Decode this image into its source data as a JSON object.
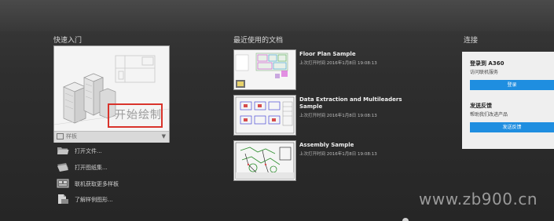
{
  "quick_start": {
    "title": "快速入门",
    "start_label": "开始绘制",
    "template_label": "样板",
    "links": [
      {
        "icon": "folder-open-icon",
        "label": "打开文件..."
      },
      {
        "icon": "sheet-set-icon",
        "label": "打开图纸集..."
      },
      {
        "icon": "online-templates-icon",
        "label": "联机获取更多样板"
      },
      {
        "icon": "sample-drawings-icon",
        "label": "了解样例图形..."
      }
    ]
  },
  "recent": {
    "title": "最近使用的文档",
    "items": [
      {
        "name": "Floor Plan Sample",
        "date": "上次打开时间 2016年1月8日 19:08:13"
      },
      {
        "name": "Data Extraction and Multileaders Sample",
        "date": "上次打开时间 2016年1月8日 19:08:13"
      },
      {
        "name": "Assembly Sample",
        "date": "上次打开时间 2016年1月8日 19:08:13"
      }
    ]
  },
  "connect": {
    "title": "连接",
    "signin_title": "登录到 A360",
    "signin_sub": "访问联机服务",
    "signin_button": "登录",
    "feedback_title": "发送反馈",
    "feedback_sub": "帮助我们改进产品",
    "feedback_button": "发送反馈",
    "accent_color": "#1f8ee0"
  },
  "watermark": "www.zb900.cn"
}
